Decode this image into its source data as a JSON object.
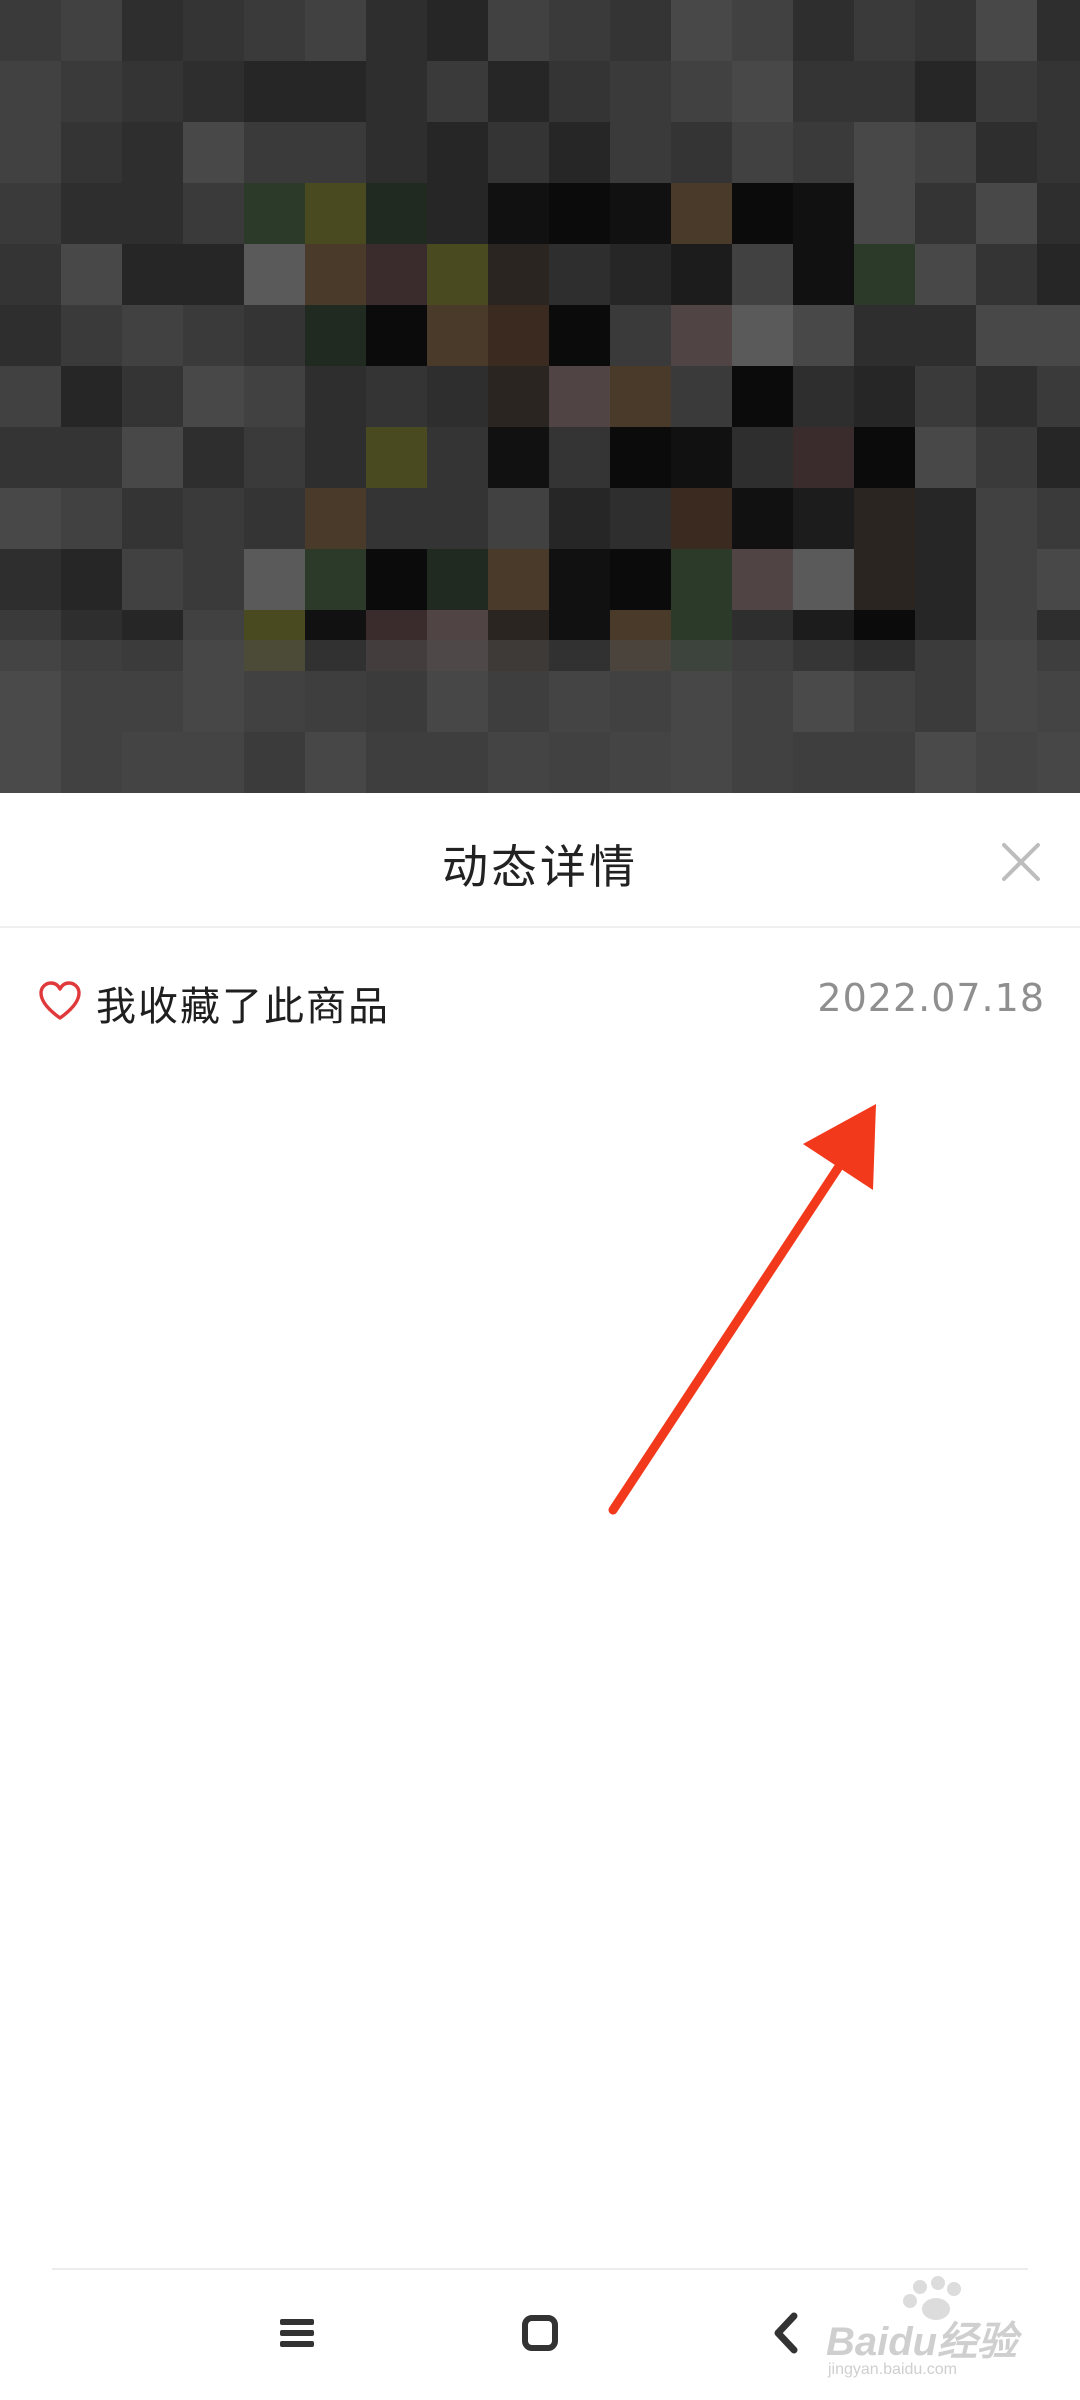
{
  "sheet": {
    "title": "动态详情"
  },
  "activity": {
    "text": "我收藏了此商品",
    "date": "2022.07.18"
  },
  "colors": {
    "accent": "#e0393b",
    "annotation": "#f2391c",
    "date": "#8f8f8f"
  },
  "icons": {
    "close": "close-icon",
    "heart": "heart-icon",
    "menu": "menu-icon",
    "home": "home-icon",
    "back": "back-icon"
  },
  "watermark": {
    "brand": "Baidu经验",
    "url": "jingyan.baidu.com"
  }
}
